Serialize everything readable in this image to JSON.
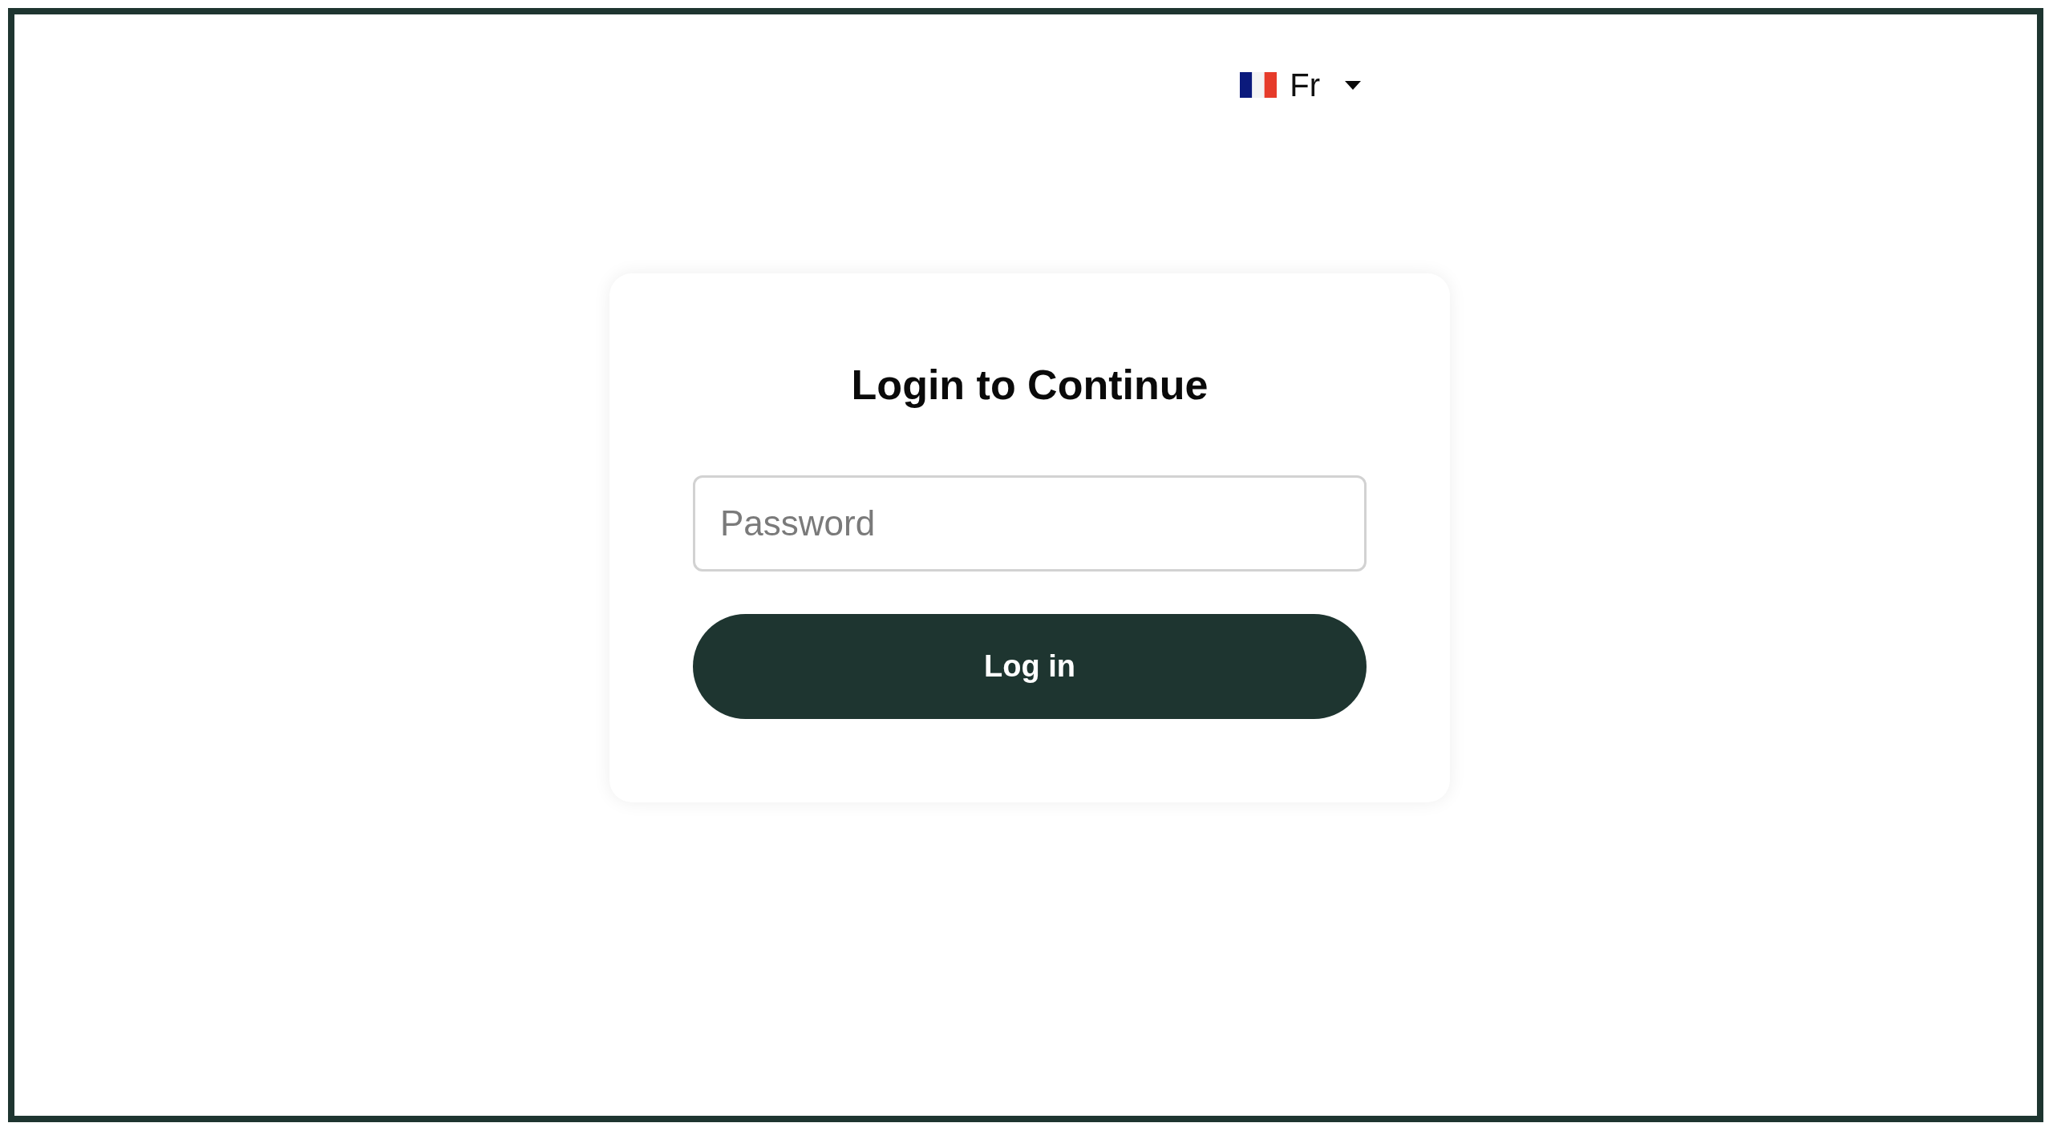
{
  "language_selector": {
    "label": "Fr"
  },
  "login_card": {
    "title": "Login to Continue",
    "password_field": {
      "placeholder": "Password"
    },
    "login_button": {
      "label": "Log in"
    }
  }
}
